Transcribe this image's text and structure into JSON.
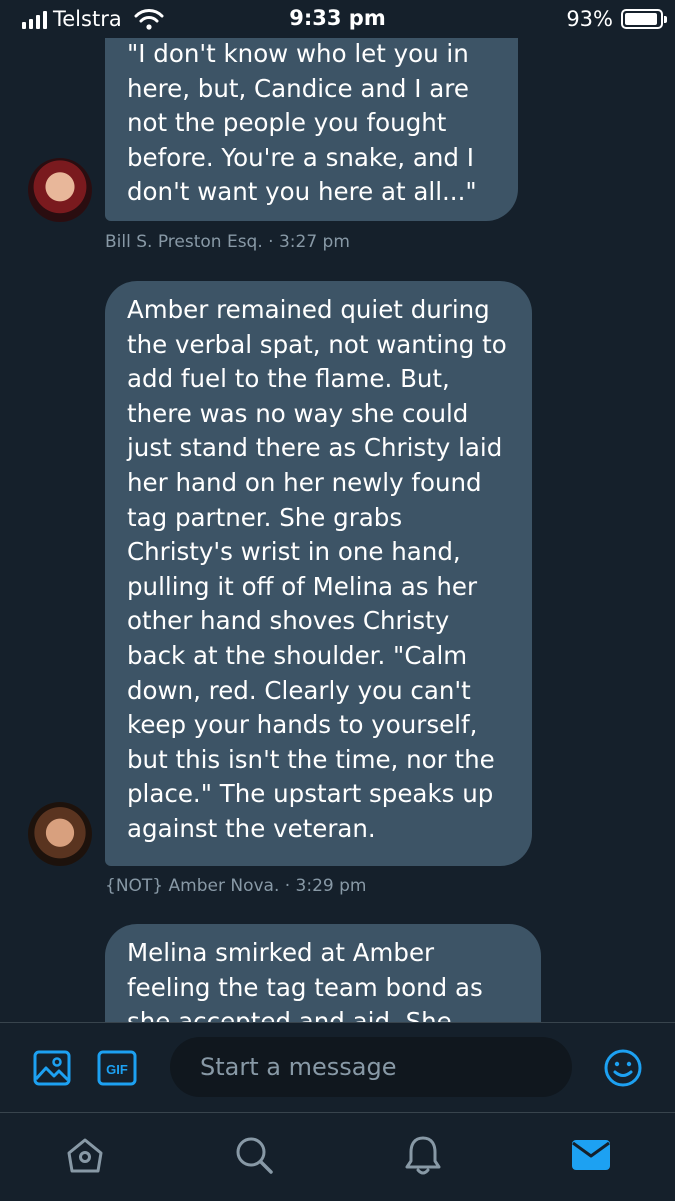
{
  "status_bar": {
    "carrier": "Telstra",
    "time": "9:33 pm",
    "battery": "93%",
    "battery_level": 0.93,
    "icons": [
      "signal-icon",
      "wifi-icon",
      "battery-icon"
    ]
  },
  "messages": [
    {
      "text": "\"I don't know who let you in\nhere, but, Candice and I are\nnot the people you fought\nbefore.  You're a snake, and I\ndon't want you here at all...\"",
      "meta": "Bill S. Preston Esq. · 3:27 pm"
    },
    {
      "text": "Amber remained quiet during\nthe verbal spat, not wanting to\nadd fuel to the flame. But,\nthere was no way she could\njust stand there as Christy laid\nher hand on her newly found\ntag partner. She grabs\nChristy's wrist in one hand,\npulling it off of Melina as her\nother hand shoves Christy\nback at the shoulder. \"Calm\ndown, red. Clearly you can't\nkeep your hands to yourself,\nbut this isn't the time, nor the\nplace.\" The upstart speaks up\nagainst the veteran.",
      "meta": "{NOT} Amber Nova. · 3:29 pm"
    },
    {
      "text": "Melina smirked at Amber\nfeeling the tag team bond as\nshe accepted and aid. She"
    }
  ],
  "composer": {
    "placeholder": "Start a message",
    "gif_label": "GIF",
    "icons": [
      "image-icon",
      "gif-icon",
      "emoji-icon"
    ]
  },
  "tabbar": {
    "icons": [
      "home-icon",
      "search-icon",
      "notifications-icon",
      "messages-icon"
    ],
    "active": "messages-icon"
  },
  "colors": {
    "background": "#15202b",
    "bubble": "#3d5466",
    "accent": "#1da1f2",
    "muted": "#8899a6"
  }
}
